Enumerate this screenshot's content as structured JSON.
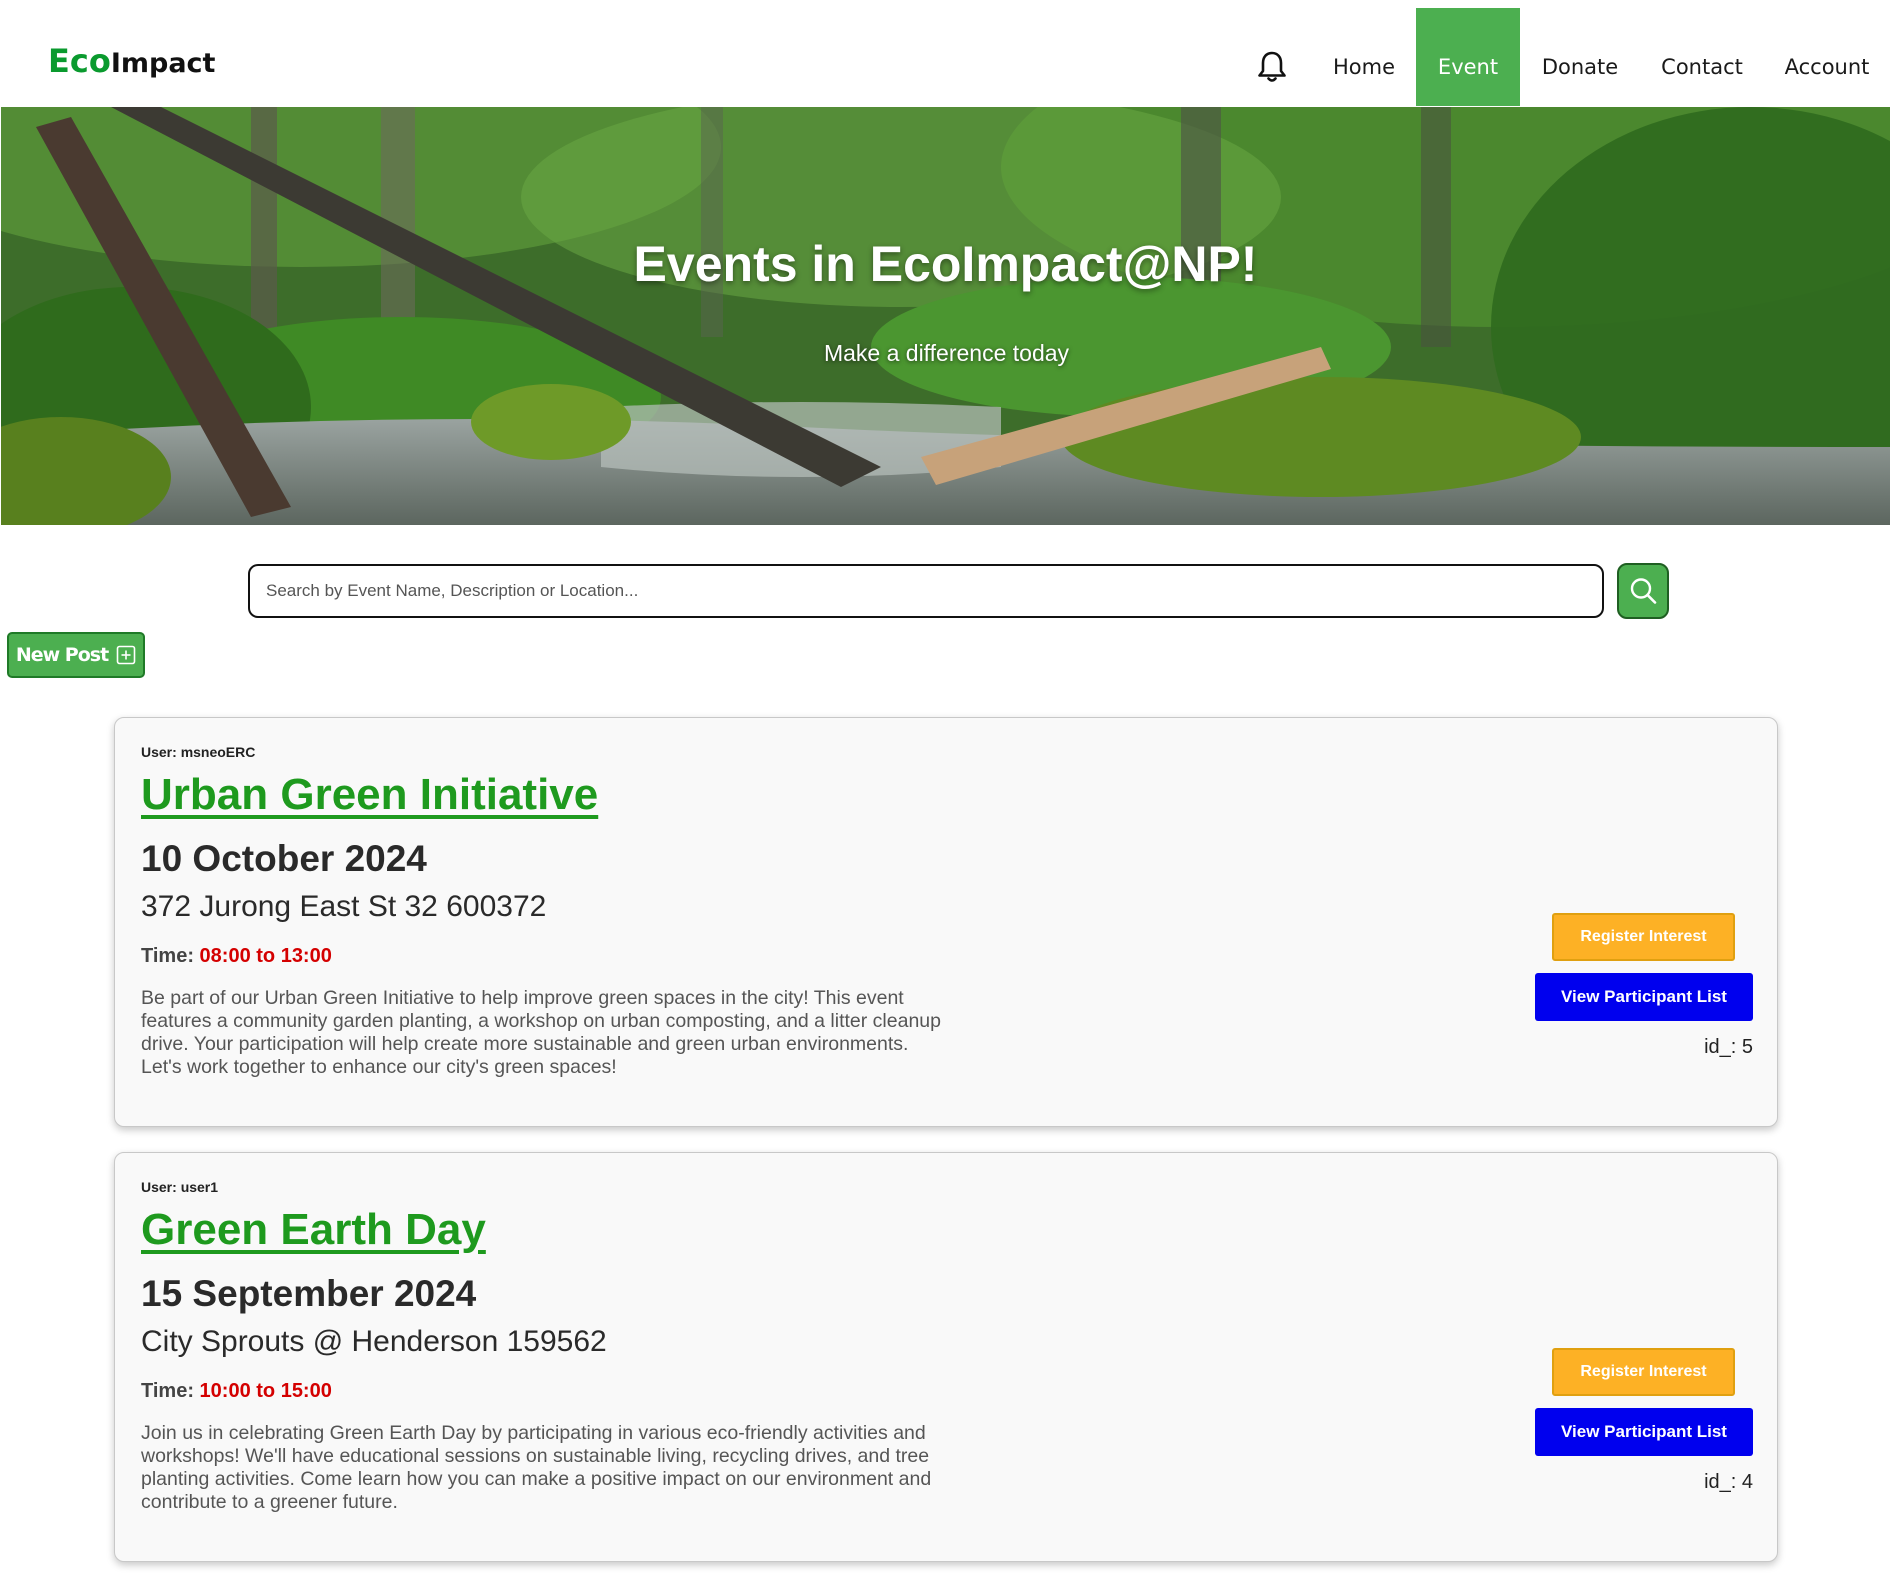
{
  "brand": {
    "eco": "Eco",
    "impact": "Impact"
  },
  "nav": {
    "bell_icon": "bell-icon",
    "items": [
      {
        "label": "Home",
        "active": false
      },
      {
        "label": "Event",
        "active": true
      },
      {
        "label": "Donate",
        "active": false
      },
      {
        "label": "Contact",
        "active": false
      },
      {
        "label": "Account",
        "active": false
      }
    ]
  },
  "hero": {
    "title": "Events in EcoImpact@NP!",
    "subtitle": "Make a difference today"
  },
  "search": {
    "placeholder": "Search by Event Name, Description or Location...",
    "value": "",
    "button_icon": "search-icon"
  },
  "new_post": {
    "label": "New Post",
    "icon": "plus-square-icon"
  },
  "events": [
    {
      "user_label": "User:",
      "user": "msneoERC",
      "title": "Urban Green Initiative",
      "date": "10 October 2024",
      "location": "372 Jurong East St 32 600372",
      "time_label": "Time:",
      "time_range": "08:00 to 13:00",
      "description": "Be part of our Urban Green Initiative to help improve green spaces in the city! This event features a community garden planting, a workshop on urban composting, and a litter cleanup drive. Your participation will help create more sustainable and green urban environments. Let's work together to enhance our city's green spaces!",
      "register_label": "Register Interest",
      "view_label": "View Participant List",
      "id_label": "id_: 5"
    },
    {
      "user_label": "User:",
      "user": "user1",
      "title": "Green Earth Day",
      "date": "15 September 2024",
      "location": "City Sprouts @ Henderson 159562",
      "time_label": "Time:",
      "time_range": "10:00 to 15:00",
      "description": "Join us in celebrating Green Earth Day by participating in various eco-friendly activities and workshops! We'll have educational sessions on sustainable living, recycling drives, and tree planting activities. Come learn how you can make a positive impact on our environment and contribute to a greener future.",
      "register_label": "Register Interest",
      "view_label": "View Participant List",
      "id_label": "id_: 4"
    }
  ],
  "colors": {
    "brand_green": "#0a9a2e",
    "nav_active": "#4caf50",
    "title_green": "#1e9a1e",
    "time_red": "#d40000",
    "register_orange": "#fdb125",
    "view_blue": "#0000ee"
  }
}
